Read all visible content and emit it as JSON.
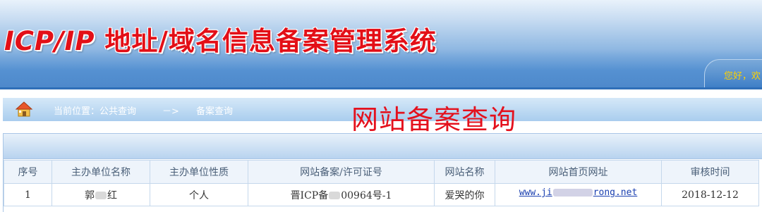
{
  "header": {
    "title_latin": "ICP/IP",
    "title_cjk": " 地址/域名信息备案管理系统",
    "greeting": "您好，欢"
  },
  "breadcrumb": {
    "location": "当前位置：公共查询",
    "arrow": "－>",
    "current": "备案查询"
  },
  "annotation": "网站备案查询",
  "table": {
    "columns": [
      "序号",
      "主办单位名称",
      "主办单位性质",
      "网站备案/许可证号",
      "网站名称",
      "网站首页网址",
      "审核时间"
    ],
    "rows": [
      {
        "index": "1",
        "owner_prefix": "郭",
        "owner_suffix": "红",
        "nature": "个人",
        "license_prefix": "晋ICP备",
        "license_suffix": "00964号-1",
        "site_name": "爱哭的你",
        "url_prefix": "www.ji",
        "url_suffix": "rong.net",
        "review_date": "2018-12-12"
      }
    ]
  },
  "colors": {
    "title_red": "#e30f17",
    "annotation_red": "#e4111d",
    "banner_blue": "#3f7fc7",
    "greeting_yellow": "#ffd200",
    "link_blue": "#1a3fb0"
  },
  "icons": {
    "breadcrumb_home": "home-icon"
  }
}
